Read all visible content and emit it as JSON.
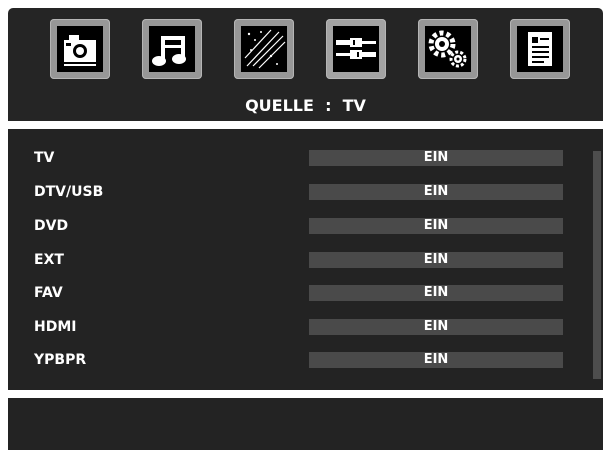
{
  "menu": {
    "icons": [
      {
        "name": "picture",
        "icon": "camera-icon"
      },
      {
        "name": "sound",
        "icon": "music-note-icon"
      },
      {
        "name": "channel",
        "icon": "satellite-icon"
      },
      {
        "name": "source",
        "icon": "cable-icon",
        "active": true
      },
      {
        "name": "setup",
        "icon": "gear-icon"
      },
      {
        "name": "info",
        "icon": "document-icon"
      }
    ]
  },
  "header": {
    "title": "QUELLE  :  TV"
  },
  "sources": [
    {
      "label": "TV",
      "value": "EIN"
    },
    {
      "label": "DTV/USB",
      "value": "EIN"
    },
    {
      "label": "DVD",
      "value": "EIN"
    },
    {
      "label": "EXT",
      "value": "EIN"
    },
    {
      "label": "FAV",
      "value": "EIN"
    },
    {
      "label": "HDMI",
      "value": "EIN"
    },
    {
      "label": "YPBPR",
      "value": "EIN"
    }
  ],
  "colors": {
    "panel": "#232323",
    "bar": "#4a4a4a",
    "tile": "#979797",
    "text": "#ffffff"
  }
}
